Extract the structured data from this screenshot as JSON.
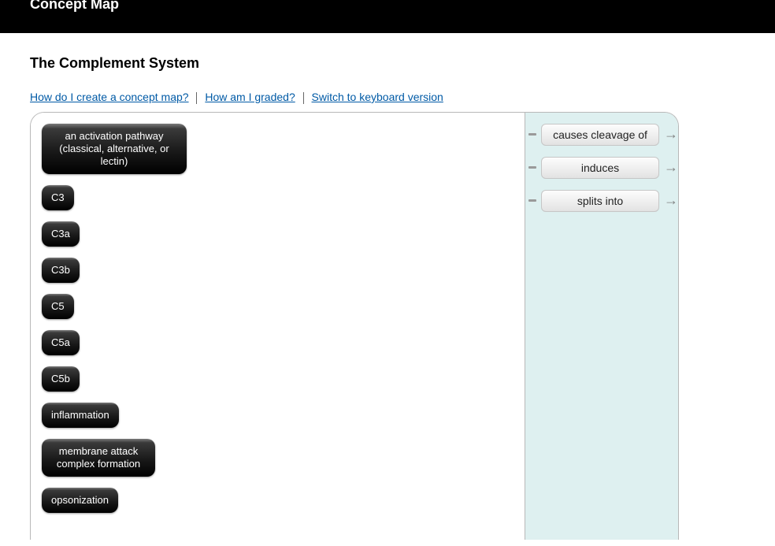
{
  "banner": {
    "title": "Concept Map"
  },
  "page": {
    "title": "The Complement System"
  },
  "help_links": {
    "create": "How do I create a concept map?",
    "graded": "How am I graded?",
    "keyboard": "Switch to keyboard version"
  },
  "nodes": {
    "activation_pathway": "an activation pathway (classical, alternative, or lectin)",
    "c3": "C3",
    "c3a": "C3a",
    "c3b": "C3b",
    "c5": "C5",
    "c5a": "C5a",
    "c5b": "C5b",
    "inflammation": "inflammation",
    "mac": "membrane attack complex formation",
    "opsonization": "opsonization"
  },
  "link_phrases": {
    "causes_cleavage": "causes cleavage of",
    "induces": "induces",
    "splits_into": "splits into"
  }
}
